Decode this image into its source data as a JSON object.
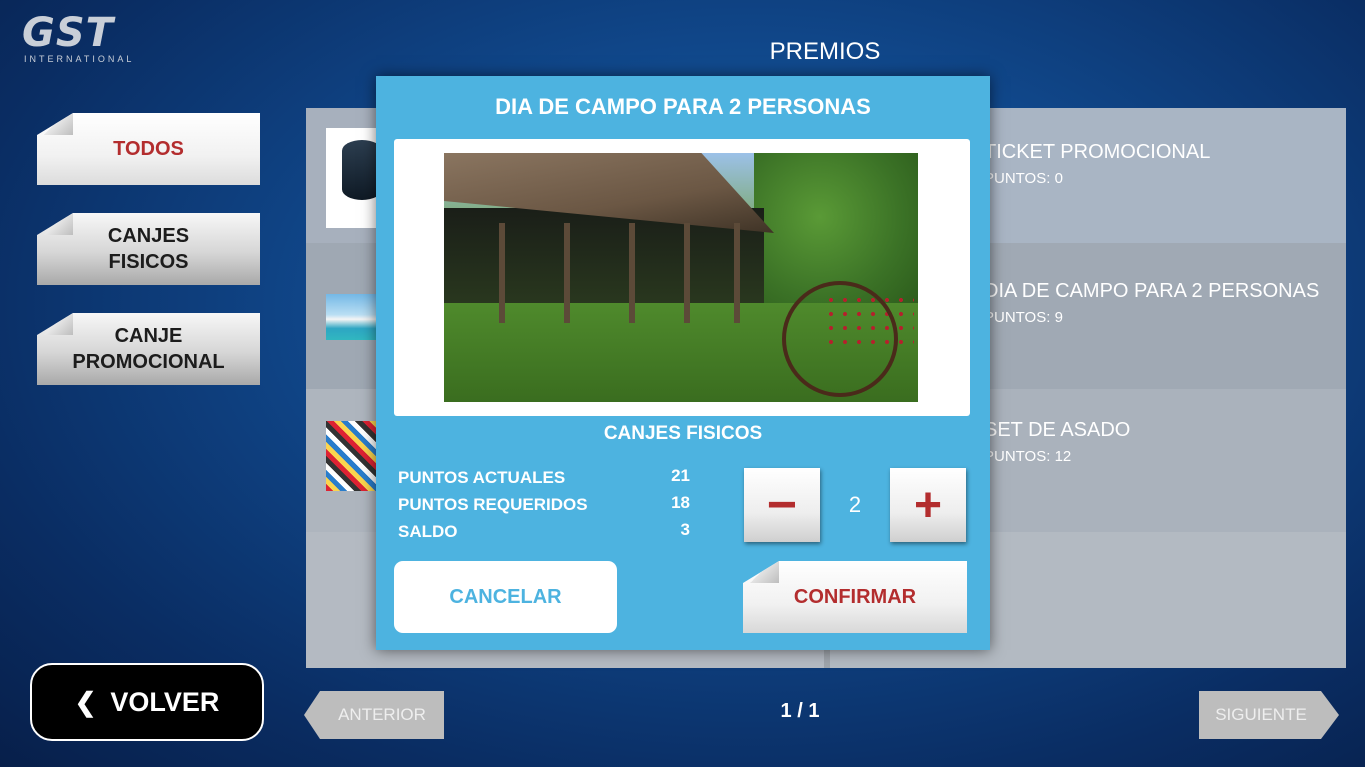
{
  "logo": {
    "name": "GST",
    "sub": "INTERNATIONAL"
  },
  "page_title": "PREMIOS",
  "categories": [
    {
      "label": "TODOS",
      "active": true
    },
    {
      "label": "CANJES FISICOS",
      "active": false
    },
    {
      "label": "CANJE PROMOCIONAL",
      "active": false
    }
  ],
  "back_label": "VOLVER",
  "products_right": [
    {
      "name": "TICKET PROMOCIONAL",
      "points": "PUNTOS: 0"
    },
    {
      "name": "DIA DE CAMPO PARA 2 PERSONAS",
      "points": "PUNTOS: 9"
    },
    {
      "name": "SET DE ASADO",
      "points": "PUNTOS: 12"
    }
  ],
  "pagination": {
    "prev": "ANTERIOR",
    "current": "1 / 1",
    "next": "SIGUIENTE"
  },
  "modal": {
    "title": "DIA DE CAMPO PARA 2 PERSONAS",
    "category": "CANJES FISICOS",
    "rows": [
      {
        "label": "PUNTOS ACTUALES",
        "value": "21"
      },
      {
        "label": "PUNTOS REQUERIDOS",
        "value": "18"
      },
      {
        "label": "SALDO",
        "value": "3"
      }
    ],
    "quantity": "2",
    "minus": "−",
    "plus": "+",
    "cancel": "CANCELAR",
    "confirm": "CONFIRMAR"
  },
  "colors": {
    "accent": "#4db3e0",
    "brand_red": "#b32d2e"
  }
}
